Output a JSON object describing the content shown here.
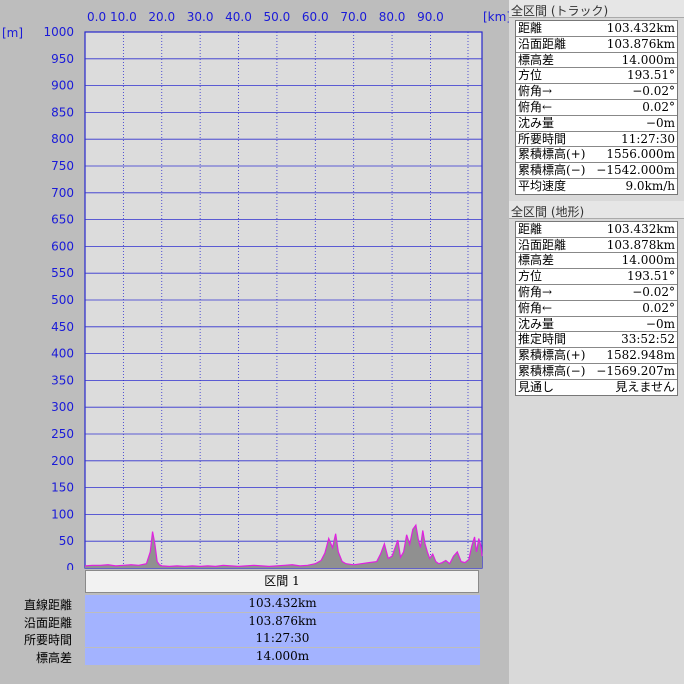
{
  "chart_data": {
    "type": "area",
    "x_unit": "[km]",
    "y_unit": "[m]",
    "x_ticks": [
      "0.0",
      "10.0",
      "20.0",
      "30.0",
      "40.0",
      "50.0",
      "60.0",
      "70.0",
      "80.0",
      "90.0"
    ],
    "y_ticks": [
      "1000",
      "950",
      "900",
      "850",
      "800",
      "750",
      "700",
      "650",
      "600",
      "550",
      "500",
      "450",
      "400",
      "350",
      "300",
      "250",
      "200",
      "150",
      "100",
      "50",
      "0"
    ],
    "xlim": [
      0,
      103.432
    ],
    "ylim": [
      0,
      1000
    ],
    "grid": true,
    "series": [
      {
        "color": "#e020e0",
        "fill": "#909090",
        "x": [
          0,
          2,
          4,
          6,
          8,
          10,
          12,
          14,
          16,
          17,
          17.6,
          18.2,
          18.8,
          19.4,
          20,
          22,
          24,
          26,
          28,
          30,
          32,
          34,
          36,
          38,
          40,
          42,
          44,
          46,
          48,
          50,
          52,
          54,
          56,
          58,
          60,
          61.5,
          62.5,
          63.5,
          64.5,
          65.3,
          66,
          67,
          68,
          70,
          72,
          74,
          76,
          77,
          78,
          79,
          80,
          80.8,
          81.5,
          82.2,
          83,
          83.8,
          84.6,
          85.4,
          86.2,
          86.8,
          87.4,
          88,
          88.6,
          89.2,
          89.8,
          90.6,
          91.4,
          92.2,
          93,
          94,
          95,
          96,
          97,
          98,
          99,
          100,
          100.8,
          101.5,
          102,
          102.6,
          103.2,
          103.432
        ],
        "y": [
          4,
          5,
          5,
          6,
          4,
          5,
          6,
          5,
          8,
          30,
          68,
          45,
          12,
          6,
          4,
          3,
          4,
          3,
          4,
          3,
          4,
          3,
          5,
          4,
          3,
          4,
          5,
          4,
          3,
          4,
          5,
          6,
          4,
          5,
          8,
          14,
          28,
          55,
          38,
          64,
          30,
          12,
          8,
          6,
          8,
          10,
          12,
          26,
          45,
          18,
          22,
          38,
          52,
          20,
          30,
          62,
          44,
          72,
          80,
          55,
          38,
          70,
          45,
          30,
          18,
          26,
          12,
          8,
          10,
          14,
          8,
          22,
          30,
          12,
          10,
          16,
          42,
          58,
          30,
          55,
          40,
          22
        ]
      }
    ]
  },
  "segment": {
    "button_label": "区間 1",
    "rows": [
      {
        "label": "直線距離",
        "value": "103.432km"
      },
      {
        "label": "沿面距離",
        "value": "103.876km"
      },
      {
        "label": "所要時間",
        "value": "11:27:30"
      },
      {
        "label": "標高差",
        "value": "14.000m"
      }
    ]
  },
  "track_panel": {
    "title": "全区間 (トラック)",
    "rows": [
      {
        "label": "距離",
        "value": "103.432km"
      },
      {
        "label": "沿面距離",
        "value": "103.876km"
      },
      {
        "label": "標高差",
        "value": "14.000m"
      },
      {
        "label": "方位",
        "value": "193.51°"
      },
      {
        "label": "俯角→",
        "value": "−0.02°"
      },
      {
        "label": "俯角←",
        "value": "0.02°"
      },
      {
        "label": "沈み量",
        "value": "−0m"
      },
      {
        "label": "所要時間",
        "value": "11:27:30"
      },
      {
        "label": "累積標高(+)",
        "value": "1556.000m"
      },
      {
        "label": "累積標高(−)",
        "value": "−1542.000m"
      },
      {
        "label": "平均速度",
        "value": "9.0km/h"
      }
    ]
  },
  "terrain_panel": {
    "title": "全区間 (地形)",
    "rows": [
      {
        "label": "距離",
        "value": "103.432km"
      },
      {
        "label": "沿面距離",
        "value": "103.878km"
      },
      {
        "label": "標高差",
        "value": "14.000m"
      },
      {
        "label": "方位",
        "value": "193.51°"
      },
      {
        "label": "俯角→",
        "value": "−0.02°"
      },
      {
        "label": "俯角←",
        "value": "0.02°"
      },
      {
        "label": "沈み量",
        "value": "−0m"
      },
      {
        "label": "推定時間",
        "value": "33:52:52"
      },
      {
        "label": "累積標高(+)",
        "value": "1582.948m"
      },
      {
        "label": "累積標高(−)",
        "value": "−1569.207m"
      },
      {
        "label": "見通し",
        "value": "見えません"
      }
    ]
  }
}
